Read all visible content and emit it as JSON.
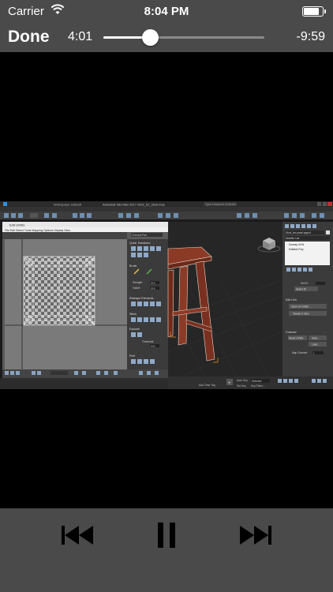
{
  "status_bar": {
    "carrier": "Carrier",
    "time": "8:04 PM",
    "battery_level": 0.85
  },
  "player": {
    "done_label": "Done",
    "elapsed": "4:01",
    "remaining": "-9:59",
    "progress": 0.29
  },
  "video_frame": {
    "window_title": "Autodesk 3ds Max 2017    ch02_02_stool.max",
    "workspace": "Workspace: Default",
    "search_placeholder": "Type a keyword or phrase",
    "uv_editor": {
      "title": "Edit UVWs",
      "menu": [
        "File",
        "Edit",
        "Select",
        "Tools",
        "Mapping",
        "Options",
        "Display",
        "View"
      ],
      "checker_label": "CheckerPatt",
      "sections": [
        "Quick Transform",
        "Brush",
        "Reshape Elements",
        "Stitch",
        "Explode",
        "Peel"
      ],
      "strength_label": "Strength:",
      "falloff_label": "Falloff:",
      "threshold_label": "Threshold:",
      "strength_value": "20.0",
      "falloff_value": "20.0",
      "threshold_value": "0.01"
    },
    "command_panel": {
      "object_name": "Stool_sm.panel.apped",
      "modifier_list": "Modifier List",
      "stack": [
        "Unwrap UVW",
        "Editable Poly"
      ],
      "edit_uvs": "Edit UVs",
      "open_editor": "Open UV Editor ...",
      "tweak": "Tweak In View",
      "channel": "Channel",
      "reset": "Reset UVWs",
      "save": "Save...",
      "load": "Load...",
      "map_channel": "Map Channel:",
      "map_channel_value": "1",
      "set_id": "Set ID:",
      "select_id": "Select ID"
    },
    "timeline": {
      "add_time_tag": "Add Time Tag",
      "auto_key": "Auto Key",
      "selected": "Selected",
      "set_key": "Set Key",
      "key_filters": "Key Filters..."
    }
  },
  "controls": {
    "previous": "previous-track-icon",
    "pause": "pause-icon",
    "next": "next-track-icon"
  }
}
